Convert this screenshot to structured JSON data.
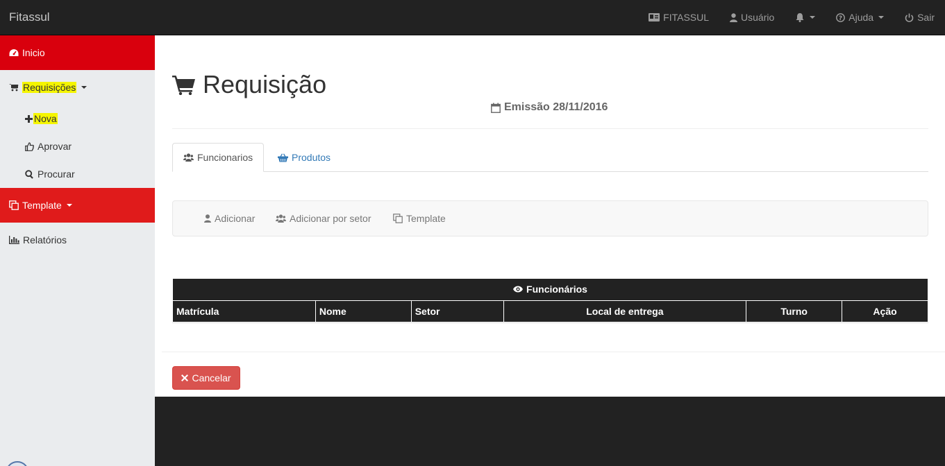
{
  "navbar": {
    "brand": "Fitassul",
    "items": [
      {
        "label": "FITASSUL",
        "icon": "id-card-icon"
      },
      {
        "label": "Usuário",
        "icon": "user-icon"
      },
      {
        "label": "",
        "icon": "bell-icon"
      },
      {
        "label": "Ajuda",
        "icon": "question-circle-icon"
      },
      {
        "label": "Sair",
        "icon": "power-icon"
      }
    ]
  },
  "sidebar": {
    "inicio": "Inicio",
    "requisicoes": "Requisições",
    "nova": "Nova",
    "aprovar": "Aprovar",
    "procurar": "Procurar",
    "template": "Template",
    "relatorios": "Relatórios"
  },
  "page": {
    "title": "Requisição",
    "emission": "Emissão 28/11/2016"
  },
  "tabs": [
    {
      "label": "Funcionarios",
      "active": true
    },
    {
      "label": "Produtos",
      "active": false
    }
  ],
  "toolbar": {
    "adicionar": "Adicionar",
    "adicionar_setor": "Adicionar por setor",
    "template": "Template"
  },
  "table": {
    "caption": "Funcionários",
    "columns": [
      "Matrícula",
      "Nome",
      "Setor",
      "Local de entrega",
      "Turno",
      "Ação"
    ],
    "rows": []
  },
  "actions": {
    "cancel": "Cancelar"
  },
  "colors": {
    "navbar": "#222222",
    "sidebar_active": "#d9000d",
    "sidebar_template": "#e01b1b",
    "highlight": "#f5f500",
    "cancel": "#d9534f",
    "link": "#337ab7"
  }
}
